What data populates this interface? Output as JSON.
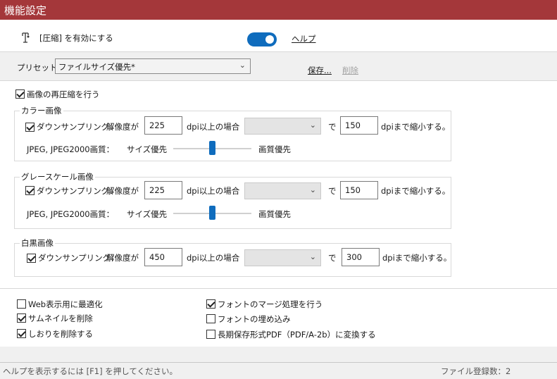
{
  "window": {
    "title": "機能設定"
  },
  "compression": {
    "label": "[圧縮] を有効にする",
    "enabled": true,
    "help_label": "ヘルプ"
  },
  "preset": {
    "label": "プリセット：",
    "value": "ファイルサイズ優先*",
    "save_label": "保存...",
    "delete_label": "削除"
  },
  "recompress": {
    "label": "画像の再圧縮を行う",
    "checked": true
  },
  "color_image": {
    "title": "カラー画像",
    "downsample_label": "ダウンサンプリング：",
    "downsample_checked": true,
    "resolution_label": "解像度が",
    "threshold_dpi": "225",
    "threshold_suffix": "dpi以上の場合",
    "method": "",
    "de_label": "で",
    "target_dpi": "150",
    "target_suffix": "dpiまで縮小する。",
    "quality_label": "JPEG, JPEG2000画質：",
    "size_priority": "サイズ優先",
    "quality_priority": "画質優先"
  },
  "gray_image": {
    "title": "グレースケール画像",
    "downsample_label": "ダウンサンプリング：",
    "downsample_checked": true,
    "resolution_label": "解像度が",
    "threshold_dpi": "225",
    "threshold_suffix": "dpi以上の場合",
    "method": "",
    "de_label": "で",
    "target_dpi": "150",
    "target_suffix": "dpiまで縮小する。",
    "quality_label": "JPEG, JPEG2000画質：",
    "size_priority": "サイズ優先",
    "quality_priority": "画質優先"
  },
  "mono_image": {
    "title": "白黒画像",
    "downsample_label": "ダウンサンプリング：",
    "downsample_checked": true,
    "resolution_label": "解像度が",
    "threshold_dpi": "450",
    "threshold_suffix": "dpi以上の場合",
    "method": "",
    "de_label": "で",
    "target_dpi": "300",
    "target_suffix": "dpiまで縮小する。"
  },
  "options": {
    "web_optimize": {
      "label": "Web表示用に最適化",
      "checked": false
    },
    "remove_thumbnail": {
      "label": "サムネイルを削除",
      "checked": true
    },
    "remove_bookmarks": {
      "label": "しおりを削除する",
      "checked": true
    },
    "merge_fonts": {
      "label": "フォントのマージ処理を行う",
      "checked": true
    },
    "embed_fonts": {
      "label": "フォントの埋め込み",
      "checked": false
    },
    "pdfa": {
      "label": "長期保存形式PDF（PDF/A-2b）に変換する",
      "checked": false
    }
  },
  "status": {
    "hint": "ヘルプを表示するには [F1] を押してください。",
    "file_count": "ファイル登録数：2"
  },
  "colors": {
    "title_bar": "#a4373a",
    "accent": "#0f6cbd"
  },
  "icons": {
    "compression": "compress-icon",
    "dropdown": "chevron-down-icon"
  }
}
